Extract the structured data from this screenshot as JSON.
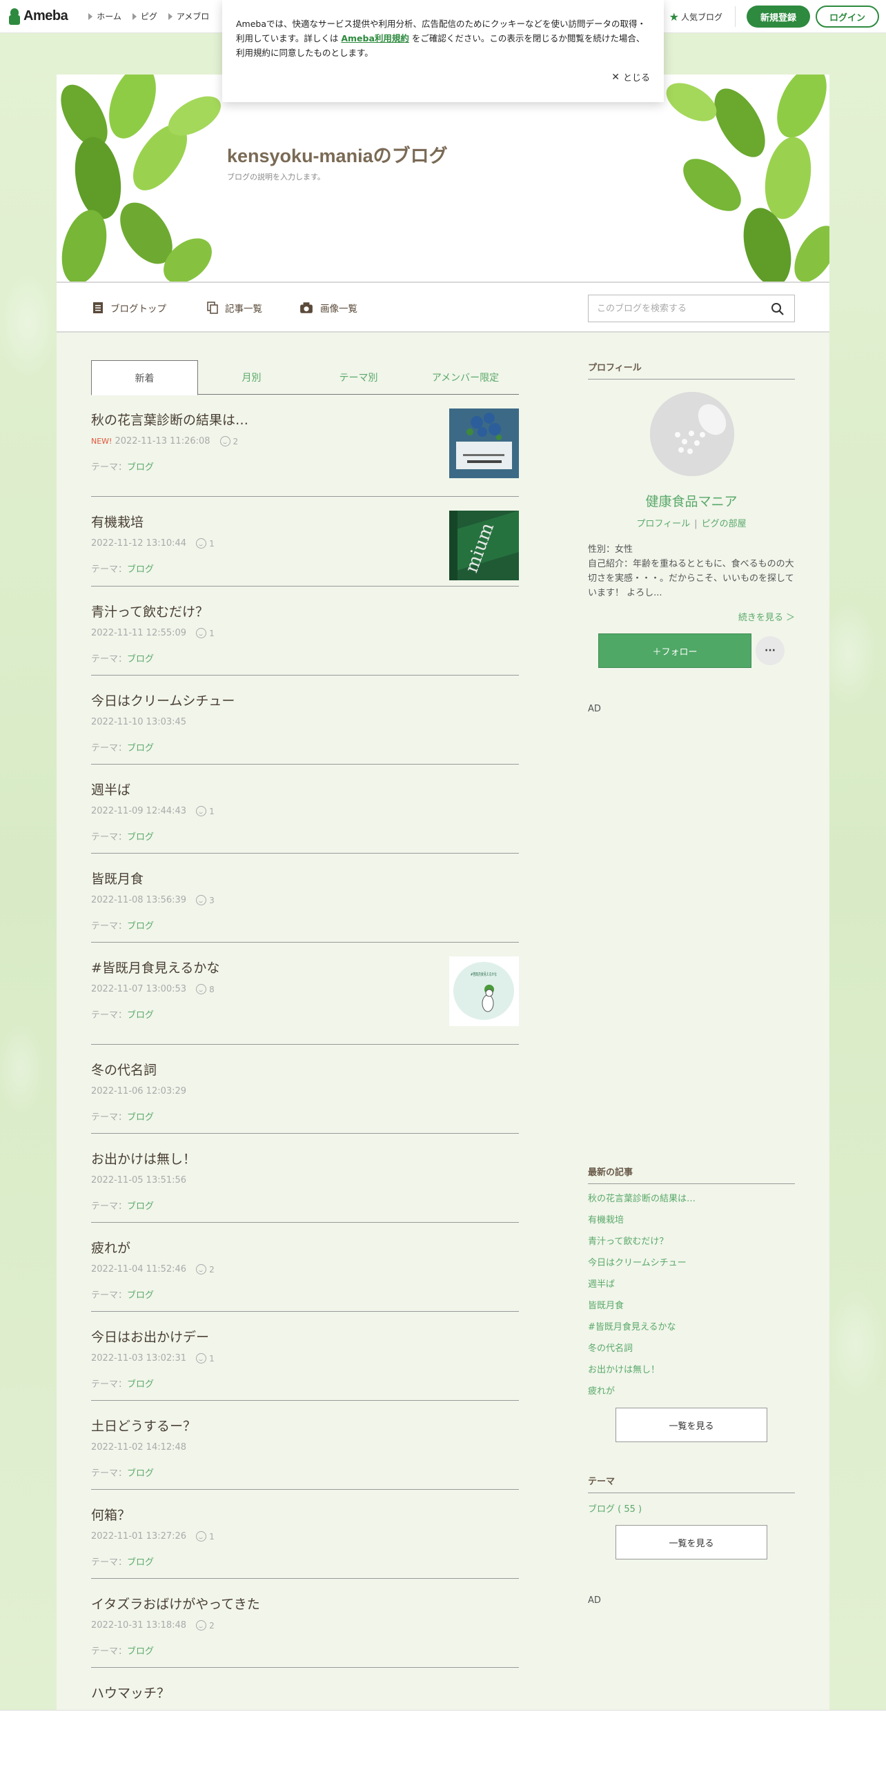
{
  "global_header": {
    "logo_text": "Ameba",
    "nav": [
      {
        "label": "ホーム"
      },
      {
        "label": "ピグ"
      },
      {
        "label": "アメブロ"
      }
    ],
    "popular_label": "人気ブログ",
    "register_label": "新規登録",
    "login_label": "ログイン"
  },
  "cookie_banner": {
    "text_before": "Amebaでは、快適なサービス提供や利用分析、広告配信のためにクッキーなどを使い訪問データの取得・利用しています。詳しくは ",
    "link_text": "Ameba利用規約",
    "text_after": " をご確認ください。この表示を閉じるか閲覧を続けた場合、利用規約に同意したものとします。",
    "close_label": "とじる"
  },
  "blog": {
    "title": "kensyoku-maniaのブログ",
    "description": "ブログの説明を入力します。"
  },
  "blog_nav": {
    "top": "ブログトップ",
    "entries": "記事一覧",
    "images": "画像一覧",
    "search_placeholder": "このブログを検索する"
  },
  "tabs": [
    "新着",
    "月別",
    "テーマ別",
    "アメンバー限定"
  ],
  "theme_prefix": "テーマ：",
  "entries": [
    {
      "title": "秋の花言葉診断の結果は…",
      "date": "2022-11-13 11:26:08",
      "new": "NEW!",
      "comments": "2",
      "theme": "ブログ",
      "thumb": "book"
    },
    {
      "title": "有機栽培",
      "date": "2022-11-12 13:10:44",
      "comments": "1",
      "theme": "ブログ",
      "thumb": "premium"
    },
    {
      "title": "青汁って飲むだけ？",
      "date": "2022-11-11 12:55:09",
      "comments": "1",
      "theme": "ブログ"
    },
    {
      "title": "今日はクリームシチュー",
      "date": "2022-11-10 13:03:45",
      "theme": "ブログ"
    },
    {
      "title": "週半ば",
      "date": "2022-11-09 12:44:43",
      "comments": "1",
      "theme": "ブログ"
    },
    {
      "title": "皆既月食",
      "date": "2022-11-08 13:56:39",
      "comments": "3",
      "theme": "ブログ"
    },
    {
      "title": "#皆既月食見えるかな",
      "date": "2022-11-07 13:00:53",
      "comments": "8",
      "theme": "ブログ",
      "thumb": "moon",
      "thumb_text": "#皆既月食見えるかな"
    },
    {
      "title": "冬の代名詞",
      "date": "2022-11-06 12:03:29",
      "theme": "ブログ"
    },
    {
      "title": "お出かけは無し！",
      "date": "2022-11-05 13:51:56",
      "theme": "ブログ"
    },
    {
      "title": "疲れが",
      "date": "2022-11-04 11:52:46",
      "comments": "2",
      "theme": "ブログ"
    },
    {
      "title": "今日はお出かけデー",
      "date": "2022-11-03 13:02:31",
      "comments": "1",
      "theme": "ブログ"
    },
    {
      "title": "土日どうするー？",
      "date": "2022-11-02 14:12:48",
      "theme": "ブログ"
    },
    {
      "title": "何箱？",
      "date": "2022-11-01 13:27:26",
      "comments": "1",
      "theme": "ブログ"
    },
    {
      "title": "イタズラおばけがやってきた",
      "date": "2022-10-31 13:18:48",
      "comments": "2",
      "theme": "ブログ"
    },
    {
      "title": "ハウマッチ？"
    }
  ],
  "sidebar": {
    "profile_heading": "プロフィール",
    "profile_name": "健康食品マニア",
    "profile_link": "プロフィール",
    "pig_link": "ピグの部屋",
    "gender": "性別：女性",
    "intro": "自己紹介：年齢を重ねるとともに、食べるものの大切さを実感・・・。だからこそ、いいものを探しています！ よろし...",
    "more": "続きを見る ＞",
    "follow": "＋フォロー",
    "more_menu": "···",
    "ad1": "AD",
    "recent_heading": "最新の記事",
    "recent": [
      "秋の花言葉診断の結果は…",
      "有機栽培",
      "青汁って飲むだけ？",
      "今日はクリームシチュー",
      "週半ば",
      "皆既月食",
      "#皆既月食見えるかな",
      "冬の代名詞",
      "お出かけは無し！",
      "疲れが"
    ],
    "recent_all": "一覧を見る",
    "theme_heading": "テーマ",
    "theme_item": "ブログ ( 55 )",
    "theme_all": "一覧を見る",
    "ad2": "AD"
  },
  "colors": {
    "brand_green": "#2d8a3e",
    "link_green": "#5aa96a",
    "title_brown": "#7a6a55",
    "new_red": "#e0553a"
  }
}
